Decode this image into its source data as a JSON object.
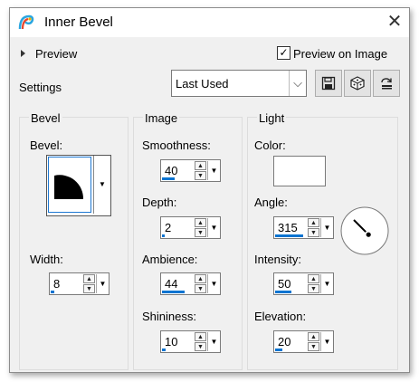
{
  "window": {
    "title": "Inner Bevel",
    "close_icon": "close-icon"
  },
  "top": {
    "preview_label": "Preview",
    "preview_on_image_label": "Preview on Image",
    "preview_on_image_checked": true
  },
  "settings": {
    "label": "Settings",
    "preset_value": "Last Used",
    "buttons": [
      "save-preset-icon",
      "randomize-icon",
      "reset-icon"
    ]
  },
  "bevel": {
    "title": "Bevel",
    "bevel_label": "Bevel:",
    "width_label": "Width:",
    "width_value": "8",
    "width_level": 0.1
  },
  "image": {
    "title": "Image",
    "smoothness_label": "Smoothness:",
    "smoothness_value": "40",
    "smoothness_level": 0.4,
    "depth_label": "Depth:",
    "depth_value": "2",
    "depth_level": 0.0,
    "ambience_label": "Ambience:",
    "ambience_value": "44",
    "ambience_level": 0.72,
    "shininess_label": "Shininess:",
    "shininess_value": "10",
    "shininess_level": 0.1
  },
  "light": {
    "title": "Light",
    "color_label": "Color:",
    "color": "#ffffff",
    "angle_label": "Angle:",
    "angle_value": "315",
    "angle_level": 0.88,
    "intensity_label": "Intensity:",
    "intensity_value": "50",
    "intensity_level": 0.5,
    "elevation_label": "Elevation:",
    "elevation_value": "20",
    "elevation_level": 0.22
  },
  "colors": {
    "accent": "#0a74d1",
    "panel": "#f0f0f0"
  }
}
